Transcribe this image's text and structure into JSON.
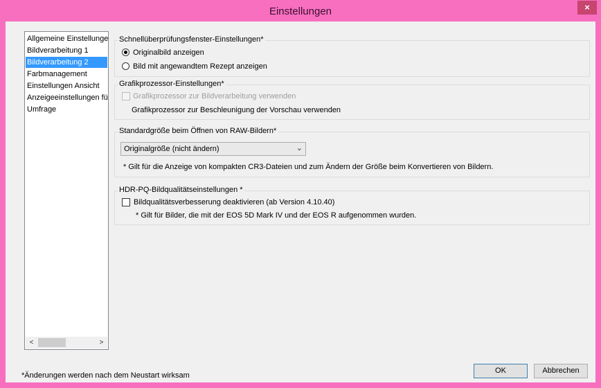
{
  "window": {
    "title": "Einstellungen",
    "close_label": "×"
  },
  "sidebar": {
    "items": [
      {
        "label": "Allgemeine Einstellungen"
      },
      {
        "label": "Bildverarbeitung 1"
      },
      {
        "label": "Bildverarbeitung 2"
      },
      {
        "label": "Farbmanagement"
      },
      {
        "label": "Einstellungen Ansicht"
      },
      {
        "label": "Anzeigeeinstellungen für"
      },
      {
        "label": "Umfrage"
      }
    ],
    "selected_index": 2,
    "scroll_left": "<",
    "scroll_right": ">"
  },
  "quickcheck": {
    "title": "Schnellüberprüfungsfenster-Einstellungen*",
    "options": [
      {
        "label": "Originalbild anzeigen",
        "selected": true
      },
      {
        "label": "Bild mit angewandtem Rezept anzeigen",
        "selected": false
      }
    ]
  },
  "gpu": {
    "title": "Grafikprozessor-Einstellungen*",
    "checkbox_label": "Grafikprozessor zur Bildverarbeitung verwenden",
    "info": "Grafikprozessor zur Beschleunigung der Vorschau verwenden"
  },
  "raw_size": {
    "title": "Standardgröße beim Öffnen von RAW-Bildern*",
    "selected_value": "Originalgröße (nicht ändern)",
    "note": "* Gilt für die Anzeige von kompakten CR3-Dateien und zum Ändern der Größe beim Konvertieren von Bildern."
  },
  "hdr": {
    "title": "HDR-PQ-Bildqualitätseinstellungen *",
    "checkbox_label": "Bildqualitätsverbesserung deaktivieren (ab Version 4.10.40)",
    "note": "* Gilt für Bilder, die mit der EOS 5D Mark IV und der EOS R aufgenommen wurden."
  },
  "footer": {
    "note": "*Änderungen werden nach dem Neustart wirksam",
    "ok_label": "OK",
    "cancel_label": "Abbrechen"
  },
  "colors": {
    "titlebar": "#f86fbf",
    "selection": "#3399ff",
    "close_button": "#c7456e"
  }
}
